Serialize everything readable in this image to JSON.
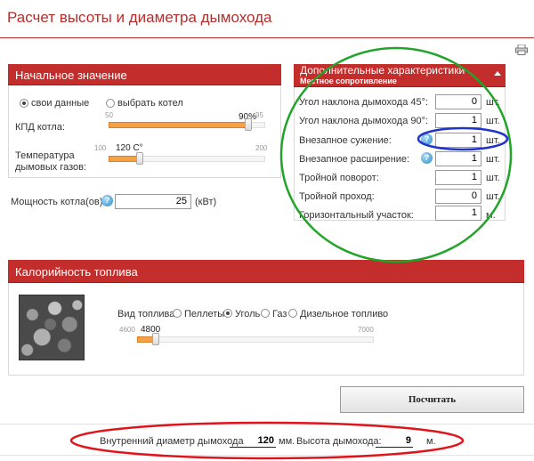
{
  "page": {
    "title": "Расчет высоты и диаметра дымохода"
  },
  "initial": {
    "header": "Начальное значение",
    "radio_own": "свои данные",
    "radio_boiler": "выбрать котел",
    "kpd_label": "КПД котла:",
    "kpd_min": "50",
    "kpd_max": "95",
    "kpd_value": "90%",
    "kpd_fraction": 0.89,
    "temp_label": "Температура дымовых газов:",
    "temp_min": "100",
    "temp_max": "200",
    "temp_value": "120 C°",
    "temp_fraction": 0.2,
    "power_label": "Мощность котла(ов):",
    "power_value": "25",
    "power_unit": "(кВт)"
  },
  "extra": {
    "header": "Дополнительные характеристики",
    "subheader": "Местное сопротивление",
    "rows": [
      {
        "label": "Угол наклона дымохода 45°:",
        "value": "0",
        "unit": "шт."
      },
      {
        "label": "Угол наклона дымохода 90°:",
        "value": "1",
        "unit": "шт."
      },
      {
        "label": "Внезапное сужение:",
        "value": "1",
        "unit": "шт."
      },
      {
        "label": "Внезапное расширение:",
        "value": "1",
        "unit": "шт."
      },
      {
        "label": "Тройной поворот:",
        "value": "1",
        "unit": "шт."
      },
      {
        "label": "Тройной проход:",
        "value": "0",
        "unit": "шт."
      },
      {
        "label": "Горизонтальный участок:",
        "value": "1",
        "unit": "м."
      }
    ]
  },
  "fuel": {
    "header": "Калорийность топлива",
    "type_label": "Вид топлива:",
    "options": [
      "Пеллеты",
      "Уголь",
      "Газ",
      "Дизельное топливо"
    ],
    "selected": "Уголь",
    "min": "4600",
    "max": "7000",
    "value": "4800",
    "fraction": 0.08
  },
  "actions": {
    "calculate": "Посчитать"
  },
  "result": {
    "diameter_label": "Внутренний диаметр дымохода",
    "diameter_value": "120",
    "diameter_unit": "мм.",
    "height_label": "Высота дымохода:",
    "height_value": "9",
    "height_unit": "м."
  },
  "colors": {
    "brand_red": "#c32d2b",
    "slider_orange": "#f4a147",
    "annotation_green": "#22a32a",
    "annotation_blue": "#2233cc",
    "annotation_red": "#e0141b"
  },
  "icons": {
    "help": "help-icon",
    "print": "print-icon"
  }
}
